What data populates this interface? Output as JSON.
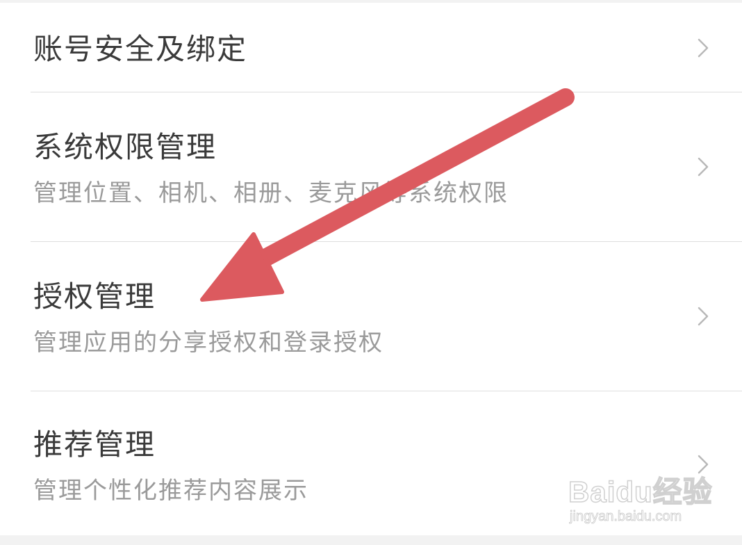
{
  "settings": {
    "items": [
      {
        "title": "账号安全及绑定",
        "desc": ""
      },
      {
        "title": "系统权限管理",
        "desc": "管理位置、相机、相册、麦克风等系统权限"
      },
      {
        "title": "授权管理",
        "desc": "管理应用的分享授权和登录授权"
      },
      {
        "title": "推荐管理",
        "desc": "管理个性化推荐内容展示"
      }
    ],
    "chevron_icon": "chevron-right-icon"
  },
  "annotation": {
    "arrow_color": "#dc5a5f",
    "arrow_icon": "arrow-annotation-icon"
  },
  "watermark": {
    "logo": "Baidu经验",
    "url": "jingyan.baidu.com"
  },
  "colors": {
    "title": "#3a3a3a",
    "desc": "#9a9a9a",
    "divider": "#dedede",
    "background": "#f2f2f2"
  }
}
